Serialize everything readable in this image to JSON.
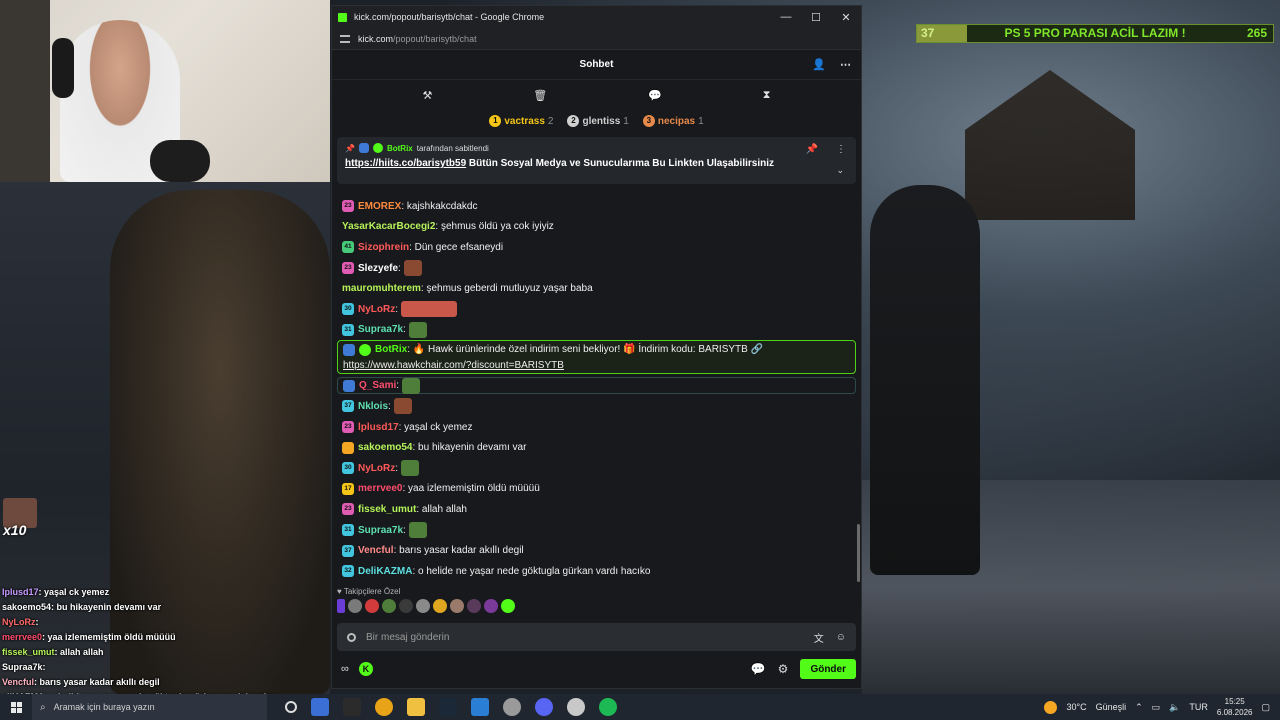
{
  "goal": {
    "current": "37",
    "label": "PS 5 PRO PARASI ACİL LAZIM !",
    "target": "265",
    "progress": 0.14
  },
  "overlay_chat": [
    {
      "user": "Iplusd17",
      "color": "#c89bff",
      "text": ": yaşal ck yemez"
    },
    {
      "user": "sakoemo54",
      "color": "#ffffff",
      "text": ": bu hikayenin devamı var"
    },
    {
      "user": "NyLoRz",
      "color": "#ff6b6b",
      "text": ":"
    },
    {
      "user": "merrvee0",
      "color": "#ff4d6d",
      "text": ": yaa izlememiştim öldü müüüü"
    },
    {
      "user": "fissek_umut",
      "color": "#b6f35a",
      "text": ": allah allah"
    },
    {
      "user": "Supraa7k",
      "color": "#ffffff",
      "text": ":"
    },
    {
      "user": "Vencful",
      "color": "#ffb3c1",
      "text": ": barıs yasar kadar akıllı degil"
    },
    {
      "user": "eliKAZMA",
      "color": "#ffffff",
      "text": ": o helide ne yaşar nede göktugla gürkan vardı hacıko"
    }
  ],
  "overlay_badge": {
    "text": "x10"
  },
  "window": {
    "title": "kick.com/popout/barisytb/chat - Google Chrome",
    "url_host": "kick.com",
    "url_path": "/popout/barisytb/chat",
    "min": "—",
    "max": "☐",
    "close": "✕"
  },
  "chat": {
    "title": "Sohbet",
    "leaderboard": [
      {
        "rank": "1",
        "name": "vactrass",
        "count": "2",
        "color": "#f5c518"
      },
      {
        "rank": "2",
        "name": "glentiss",
        "count": "1",
        "color": "#cfcfcf"
      },
      {
        "rank": "3",
        "name": "necipas",
        "count": "1",
        "color": "#e7894a"
      }
    ],
    "pinned": {
      "by_user": "BotRix",
      "by_text": "tarafından sabitlendi",
      "link": "https://hiits.co/barisytb59",
      "text": " Bütün Sosyal Medya ve Sunucularıma Bu Linkten Ulaşabilirsiniz"
    },
    "messages": [
      {
        "badge": "23",
        "badge_color": "#e05cb4",
        "user": "EMOREX",
        "user_color": "#ff8a3d",
        "text": ": kajshkakcdakdc"
      },
      {
        "badge": "",
        "badge_color": "",
        "user": "YasarKacarBocegi2",
        "user_color": "#b6f35a",
        "text": ": şehmus öldü ya cok iyiyiz"
      },
      {
        "badge": "41",
        "badge_color": "#47c97a",
        "user": "Sizophrein",
        "user_color": "#ff5a5a",
        "text": ": Dün gece efsaneydi"
      },
      {
        "badge": "23",
        "badge_color": "#e05cb4",
        "user": "Slezyefe",
        "user_color": "#ffffff",
        "text": ":",
        "emote": "#8a4a32"
      },
      {
        "badge": "",
        "badge_color": "",
        "user": "mauromuhterem",
        "user_color": "#b6f35a",
        "text": ": şehmus geberdi mutluyuz yaşar baba"
      },
      {
        "badge": "30",
        "badge_color": "#42c6e0",
        "user": "NyLoRz",
        "user_color": "#ff5a5a",
        "text": ":",
        "emote": "#c9574a",
        "wide": true
      },
      {
        "badge": "31",
        "badge_color": "#42c6e0",
        "user": "Supraa7k",
        "user_color": "#5ee0b0",
        "text": ":",
        "emote": "#4f7d3a"
      }
    ],
    "bot_message": {
      "user": "BotRix",
      "text": ": 🔥 Hawk ürünlerinde özel indirim seni bekliyor! 🎁 İndirim kodu: BARISYTB 🔗",
      "link": "https://www.hawkchair.com/?discount=BARISYTB"
    },
    "messages2": [
      {
        "badge": "",
        "badge_color": "#3f7ad6",
        "user": "Q_Sami",
        "user_color": "#ff4d6d",
        "text": ":",
        "emote": "#4f7d3a",
        "outline": true
      },
      {
        "badge": "37",
        "badge_color": "#42c6e0",
        "user": "Nklois",
        "user_color": "#5ee0b0",
        "text": ":",
        "emote": "#8a4a32"
      },
      {
        "badge": "23",
        "badge_color": "#e05cb4",
        "user": "lplusd17",
        "user_color": "#ff5a5a",
        "text": ": yaşal ck yemez"
      },
      {
        "badge": "",
        "badge_color": "#f5a623",
        "user": "sakoemo54",
        "user_color": "#b6f35a",
        "text": ": bu hikayenin devamı var"
      },
      {
        "badge": "30",
        "badge_color": "#42c6e0",
        "user": "NyLoRz",
        "user_color": "#ff5a5a",
        "text": ":",
        "emote": "#4f7d3a"
      },
      {
        "badge": "17",
        "badge_color": "#f5c518",
        "user": "merrvee0",
        "user_color": "#ff4d6d",
        "text": ": yaa izlememiştim öldü müüüü"
      },
      {
        "badge": "23",
        "badge_color": "#e05cb4",
        "user": "fissek_umut",
        "user_color": "#b6f35a",
        "text": ": allah allah"
      },
      {
        "badge": "31",
        "badge_color": "#42c6e0",
        "user": "Supraa7k",
        "user_color": "#5ee0b0",
        "text": ":",
        "emote": "#4f7d3a"
      },
      {
        "badge": "37",
        "badge_color": "#42c6e0",
        "user": "Vencful",
        "user_color": "#ff8a8a",
        "text": ": barıs yasar kadar akıllı degil"
      },
      {
        "badge": "32",
        "badge_color": "#42c6e0",
        "user": "DeliKAZMA",
        "user_color": "#5ee0e0",
        "text": ": o helide ne yaşar nede göktugla gürkan vardı hacıko"
      }
    ],
    "emote_tray_label": "Takipçilere Özel",
    "input_placeholder": "Bir mesaj gönderin",
    "send_label": "Gönder"
  },
  "taskbar": {
    "search_placeholder": "Aramak için buraya yazın",
    "temperature": "30°C",
    "weather": "Güneşli",
    "lang": "TUR",
    "time": "15:25",
    "date": "6.08.2026"
  }
}
